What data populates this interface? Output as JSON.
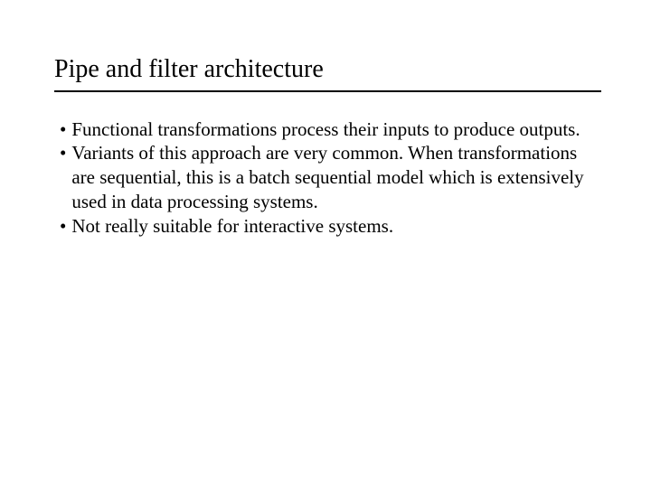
{
  "title": "Pipe and filter architecture",
  "bullets": [
    "Functional transformations process their inputs to produce outputs.",
    "Variants of this approach are very common. When transformations are sequential, this is a batch sequential model which is extensively used in data processing systems.",
    "Not really suitable for interactive systems."
  ]
}
